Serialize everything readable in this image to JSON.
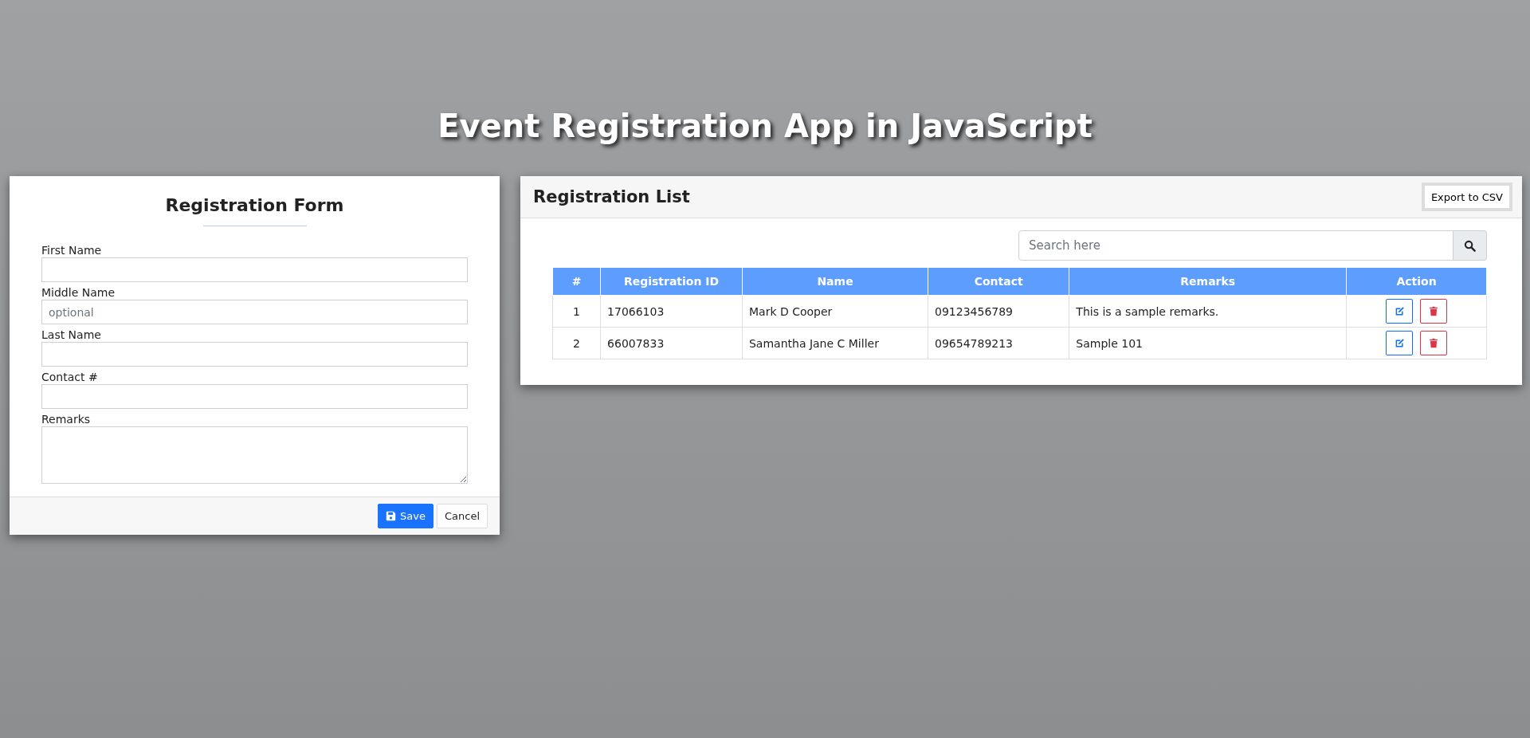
{
  "page_title": "Event Registration App in JavaScript",
  "form": {
    "title": "Registration Form",
    "fields": [
      {
        "label": "First Name",
        "kind": "input"
      },
      {
        "label": "Middle Name",
        "kind": "input",
        "placeholder": "optional"
      },
      {
        "label": "Last Name",
        "kind": "input"
      },
      {
        "label": "Contact #",
        "kind": "input"
      },
      {
        "label": "Remarks",
        "kind": "textarea"
      }
    ],
    "buttons": [
      {
        "label": "Save",
        "kind": "primary"
      },
      {
        "label": "Cancel",
        "kind": "plain"
      }
    ]
  },
  "list": {
    "title": "Registration List",
    "export_button": "Export to CSV",
    "search": {
      "placeholder": "Search here"
    },
    "table": {
      "columns": [
        "#",
        "Registration ID",
        "Name",
        "Contact",
        "Remarks",
        "Action"
      ],
      "rows": [
        {
          "cells": [
            "1",
            "17066103",
            "Mark D Cooper",
            "09123456789",
            "This is a sample remarks."
          ]
        },
        {
          "cells": [
            "2",
            "66007833",
            "Samantha Jane C Miller",
            "09654789213",
            "Sample 101"
          ]
        }
      ]
    }
  }
}
